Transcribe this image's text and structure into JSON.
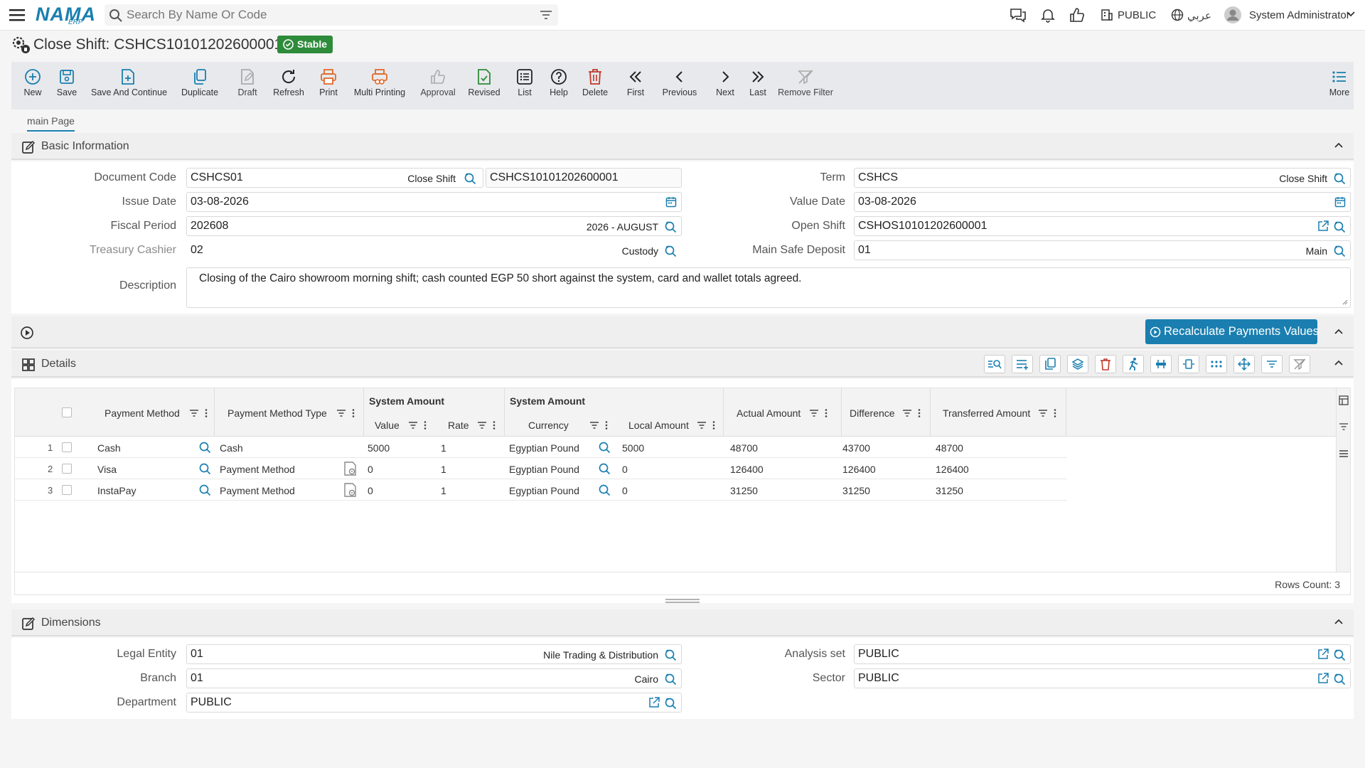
{
  "topbar": {
    "logo_text": "NAMA",
    "logo_sub": "ERP",
    "search_placeholder": "Search By Name Or Code",
    "public_label": "PUBLIC",
    "language_label": "عربي",
    "user_name": "System Administrator"
  },
  "page": {
    "title": "Close Shift: CSHCS10101202600001",
    "status": "Stable"
  },
  "toolbar": {
    "new": "New",
    "save": "Save",
    "save_continue": "Save And Continue",
    "duplicate": "Duplicate",
    "draft": "Draft",
    "refresh": "Refresh",
    "print": "Print",
    "multi_printing": "Multi Printing",
    "approval": "Approval",
    "revised": "Revised",
    "list": "List",
    "help": "Help",
    "delete": "Delete",
    "first": "First",
    "previous": "Previous",
    "next": "Next",
    "last": "Last",
    "remove_filter": "Remove Filter",
    "more": "More"
  },
  "tabs": {
    "main": "main Page"
  },
  "basic": {
    "title": "Basic Information",
    "document_code": {
      "label": "Document Code",
      "value": "CSHCS01",
      "tag": "Close Shift",
      "number": "CSHCS10101202600001"
    },
    "issue_date": {
      "label": "Issue Date",
      "value": "03-08-2026"
    },
    "fiscal_period": {
      "label": "Fiscal Period",
      "value": "202608",
      "tag": "2026 - AUGUST"
    },
    "treasury_cashier": {
      "label": "Treasury Cashier",
      "value": "02",
      "tag": "Custody"
    },
    "description": {
      "label": "Description",
      "value": "Closing of the Cairo showroom morning shift; cash counted EGP 50 short against the system, card and wallet totals agreed."
    },
    "term": {
      "label": "Term",
      "value": "CSHCS",
      "tag": "Close Shift"
    },
    "value_date": {
      "label": "Value Date",
      "value": "03-08-2026"
    },
    "open_shift": {
      "label": "Open Shift",
      "value": "CSHOS10101202600001"
    },
    "main_safe_deposit": {
      "label": "Main Safe Deposit",
      "value": "01",
      "tag": "Main"
    }
  },
  "recalc_button": "Recalculate Payments Values",
  "details": {
    "title": "Details",
    "columns": {
      "payment_method": "Payment Method",
      "payment_method_type": "Payment Method Type",
      "system_amount_group1": "System Amount",
      "value": "Value",
      "rate": "Rate",
      "system_amount_group2": "System Amount",
      "currency": "Currency",
      "local_amount": "Local Amount",
      "actual_amount": "Actual Amount",
      "difference": "Difference",
      "transferred_amount": "Transferred Amount"
    },
    "rows": [
      {
        "n": "1",
        "method": "Cash",
        "type": "Cash",
        "value": "5000",
        "rate": "1",
        "currency": "Egyptian Pound",
        "local": "5000",
        "actual": "48700",
        "difference": "43700",
        "transferred": "48700"
      },
      {
        "n": "2",
        "method": "Visa",
        "type": "Payment Method",
        "value": "0",
        "rate": "1",
        "currency": "Egyptian Pound",
        "local": "0",
        "actual": "126400",
        "difference": "126400",
        "transferred": "126400"
      },
      {
        "n": "3",
        "method": "InstaPay",
        "type": "Payment Method",
        "value": "0",
        "rate": "1",
        "currency": "Egyptian Pound",
        "local": "0",
        "actual": "31250",
        "difference": "31250",
        "transferred": "31250"
      }
    ],
    "rows_count": "Rows Count: 3"
  },
  "dimensions": {
    "title": "Dimensions",
    "legal_entity": {
      "label": "Legal Entity",
      "value": "01",
      "tag": "Nile Trading & Distribution"
    },
    "branch": {
      "label": "Branch",
      "value": "01",
      "tag": "Cairo"
    },
    "department": {
      "label": "Department",
      "value": "PUBLIC"
    },
    "analysis_set": {
      "label": "Analysis set",
      "value": "PUBLIC"
    },
    "sector": {
      "label": "Sector",
      "value": "PUBLIC"
    }
  },
  "colors": {
    "accent": "#1a7fb0",
    "stable_badge": "#2e8b3a",
    "print_orange": "#e06a2b",
    "delete_red": "#c0392b",
    "revised_green": "#2e8b3a"
  }
}
